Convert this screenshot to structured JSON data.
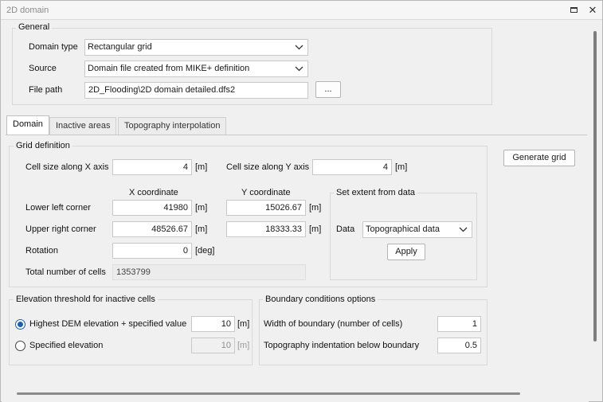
{
  "window": {
    "title": "2D domain"
  },
  "general": {
    "legend": "General",
    "domain_type": {
      "label": "Domain type",
      "value": "Rectangular grid"
    },
    "source": {
      "label": "Source",
      "value": "Domain file created from MIKE+ definition"
    },
    "file_path": {
      "label": "File path",
      "value": "2D_Flooding\\2D domain detailed.dfs2",
      "browse": "..."
    }
  },
  "tabs": [
    {
      "label": "Domain",
      "active": true
    },
    {
      "label": "Inactive areas",
      "active": false
    },
    {
      "label": "Topography interpolation",
      "active": false
    }
  ],
  "grid": {
    "legend": "Grid definition",
    "cell_x": {
      "label": "Cell size along X axis",
      "value": "4",
      "unit": "[m]"
    },
    "cell_y": {
      "label": "Cell size along Y axis",
      "value": "4",
      "unit": "[m]"
    },
    "x_header": "X coordinate",
    "y_header": "Y coordinate",
    "lower_left": {
      "label": "Lower left corner",
      "x": "41980",
      "y": "15026.67",
      "unit": "[m]"
    },
    "upper_right": {
      "label": "Upper right corner",
      "x": "48526.67",
      "y": "18333.33",
      "unit": "[m]"
    },
    "rotation": {
      "label": "Rotation",
      "value": "0",
      "unit": "[deg]"
    },
    "total_cells": {
      "label": "Total number of cells",
      "value": "1353799"
    },
    "extent": {
      "legend": "Set extent from data",
      "data_label": "Data",
      "data_value": "Topographical data",
      "apply": "Apply"
    }
  },
  "generate_grid": "Generate grid",
  "elevation": {
    "legend": "Elevation threshold for inactive cells",
    "option1": {
      "label": "Highest DEM elevation + specified value",
      "value": "10",
      "unit": "[m]",
      "checked": true
    },
    "option2": {
      "label": "Specified elevation",
      "value": "10",
      "unit": "[m]",
      "checked": false
    }
  },
  "boundary": {
    "legend": "Boundary conditions options",
    "width": {
      "label": "Width of boundary (number of cells)",
      "value": "1"
    },
    "indent": {
      "label": "Topography indentation below boundary",
      "value": "0.5"
    }
  }
}
